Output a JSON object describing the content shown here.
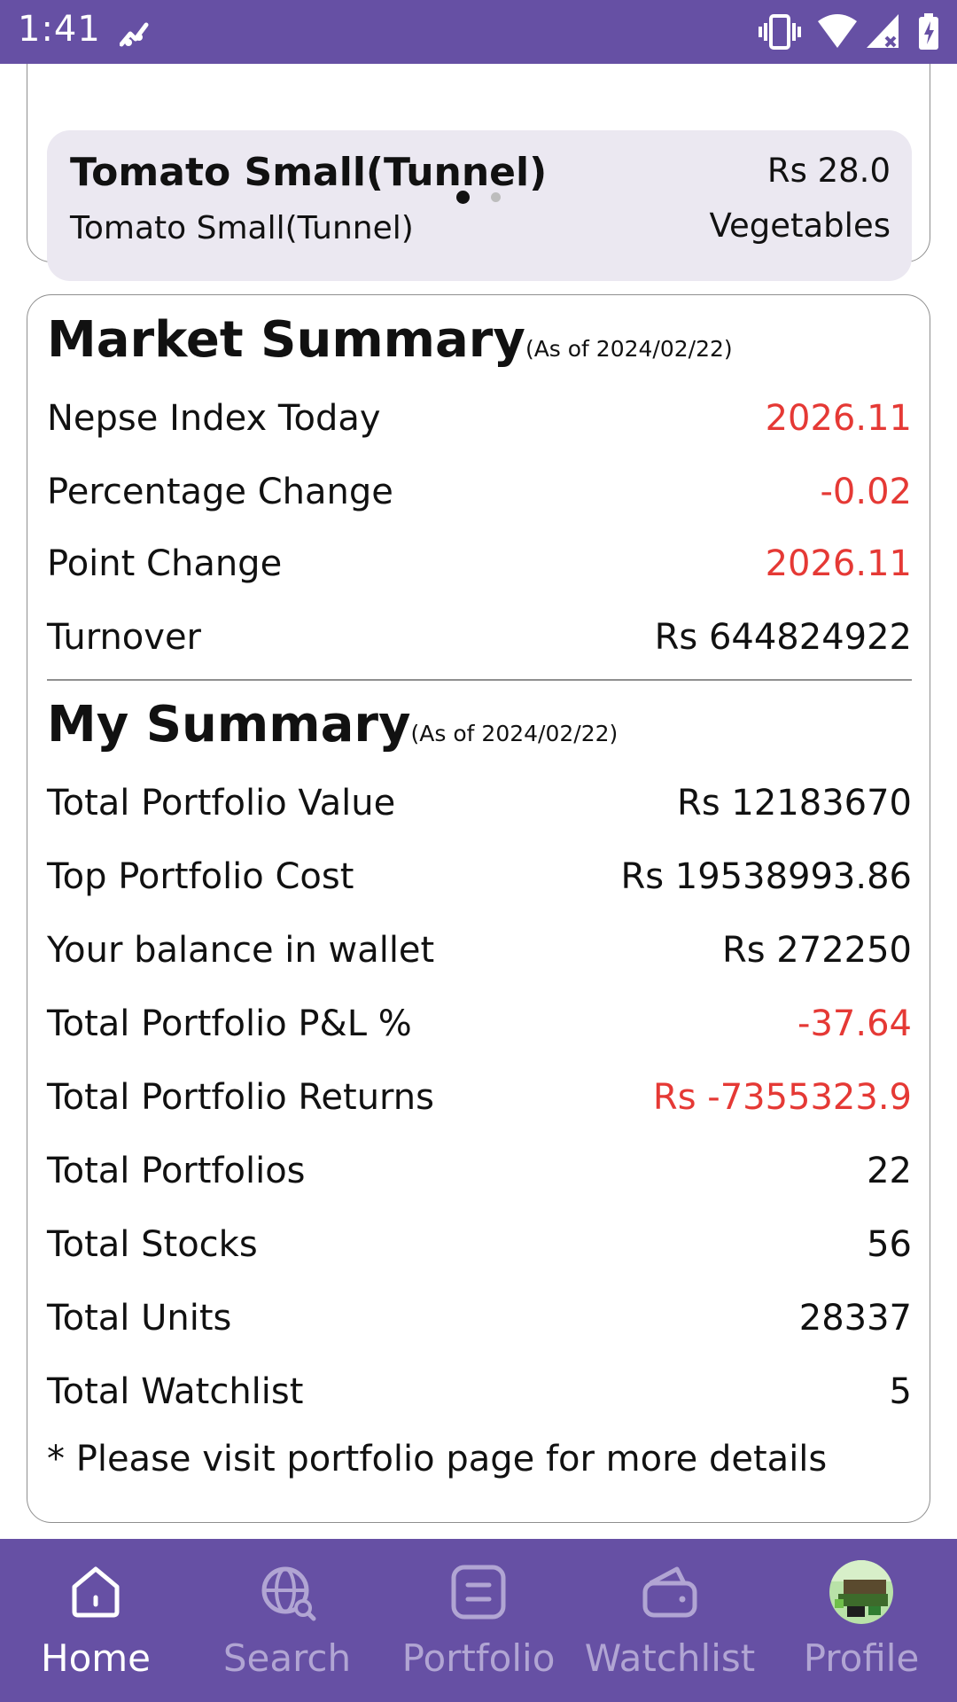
{
  "status_bar": {
    "time": "1:41",
    "icons": [
      "trend-icon",
      "vibrate-icon",
      "wifi-icon",
      "signal-icon",
      "battery-charging-icon"
    ]
  },
  "carousel": {
    "item_name": "Tomato Small(Tunnel)",
    "item_subtitle": "Tomato Small(Tunnel)",
    "price": "Rs 28.0",
    "category": "Vegetables",
    "active_page": 1,
    "page_count": 2
  },
  "market_summary": {
    "title": "Market Summary",
    "as_of": "(As of 2024/02/22)",
    "rows": [
      {
        "label": "Nepse Index Today",
        "value": "2026.11",
        "negative": true
      },
      {
        "label": "Percentage Change",
        "value": "-0.02",
        "negative": true
      },
      {
        "label": "Point Change",
        "value": "2026.11",
        "negative": true
      },
      {
        "label": "Turnover",
        "value": "Rs 644824922",
        "negative": false
      }
    ]
  },
  "my_summary": {
    "title": "My Summary",
    "as_of": "(As of 2024/02/22)",
    "rows": [
      {
        "label": "Total Portfolio Value",
        "value": "Rs 12183670",
        "negative": false
      },
      {
        "label": "Top Portfolio Cost",
        "value": "Rs 19538993.86",
        "negative": false
      },
      {
        "label": "Your balance in wallet",
        "value": "Rs 272250",
        "negative": false
      },
      {
        "label": "Total Portfolio P&L %",
        "value": "-37.64",
        "negative": true
      },
      {
        "label": "Total Portfolio Returns",
        "value": "Rs -7355323.9",
        "negative": true
      },
      {
        "label": "Total Portfolios",
        "value": "22",
        "negative": false
      },
      {
        "label": "Total Stocks",
        "value": "56",
        "negative": false
      },
      {
        "label": "Total Units",
        "value": "28337",
        "negative": false
      },
      {
        "label": "Total Watchlist",
        "value": "5",
        "negative": false
      }
    ],
    "note": "* Please visit portfolio page for more details"
  },
  "bottom_nav": {
    "items": [
      {
        "label": "Home",
        "icon": "home-icon",
        "active": true
      },
      {
        "label": "Search",
        "icon": "globe-search-icon",
        "active": false
      },
      {
        "label": "Portfolio",
        "icon": "portfolio-icon",
        "active": false
      },
      {
        "label": "Watchlist",
        "icon": "wallet-icon",
        "active": false
      },
      {
        "label": "Profile",
        "icon": "avatar",
        "active": false
      }
    ]
  },
  "colors": {
    "brand": "#6650a4",
    "negative": "#e53935",
    "card_fill": "#ebe8f1",
    "nav_inactive": "#b1a5d3"
  }
}
